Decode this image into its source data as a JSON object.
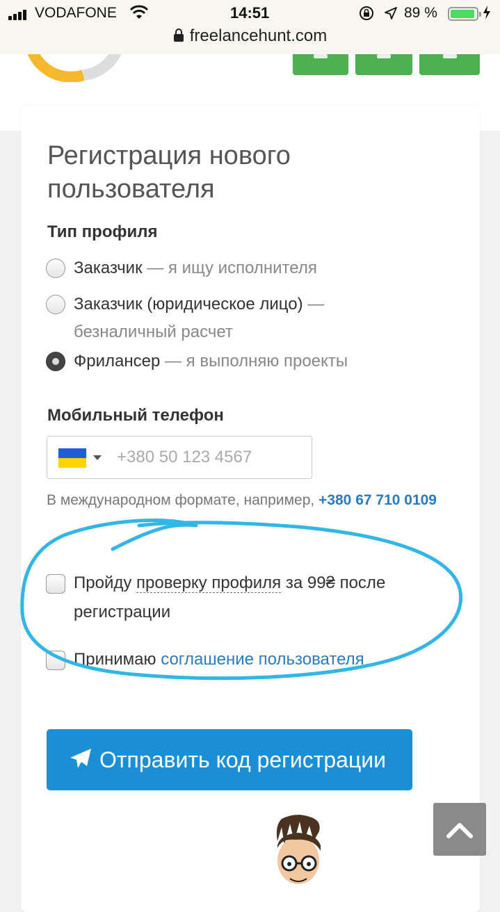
{
  "status_bar": {
    "carrier": "VODAFONE",
    "time": "14:51",
    "battery_percent": "89 %",
    "battery_level": 0.89
  },
  "browser": {
    "url": "freelancehunt.com"
  },
  "form": {
    "title": "Регистрация нового пользователя",
    "profile_type_label": "Тип профиля",
    "profile_options": [
      {
        "name": "Заказчик",
        "desc": "— я ищу исполнителя",
        "selected": false
      },
      {
        "name": "Заказчик (юридическое лицо)",
        "desc": "— безналичный расчет",
        "selected": false
      },
      {
        "name": "Фрилансер",
        "desc": "— я выполняю проекты",
        "selected": true
      }
    ],
    "phone_label": "Мобильный телефон",
    "phone_placeholder": "+380 50 123 4567",
    "phone_hint": "В международном формате, например,",
    "phone_hint_example": "+380 67 710 0109",
    "verify_pre": "Пройду",
    "verify_link": "проверку профиля",
    "verify_post": "за 99₴ после регистрации",
    "agree_pre": "Принимаю",
    "agree_link": "соглашение пользователя",
    "submit_label": "Отправить код регистрации"
  },
  "colors": {
    "accent": "#1a8fd6",
    "link": "#2b7bbd",
    "header_buttons": "#4caf50",
    "annotation": "#33b5e5"
  }
}
